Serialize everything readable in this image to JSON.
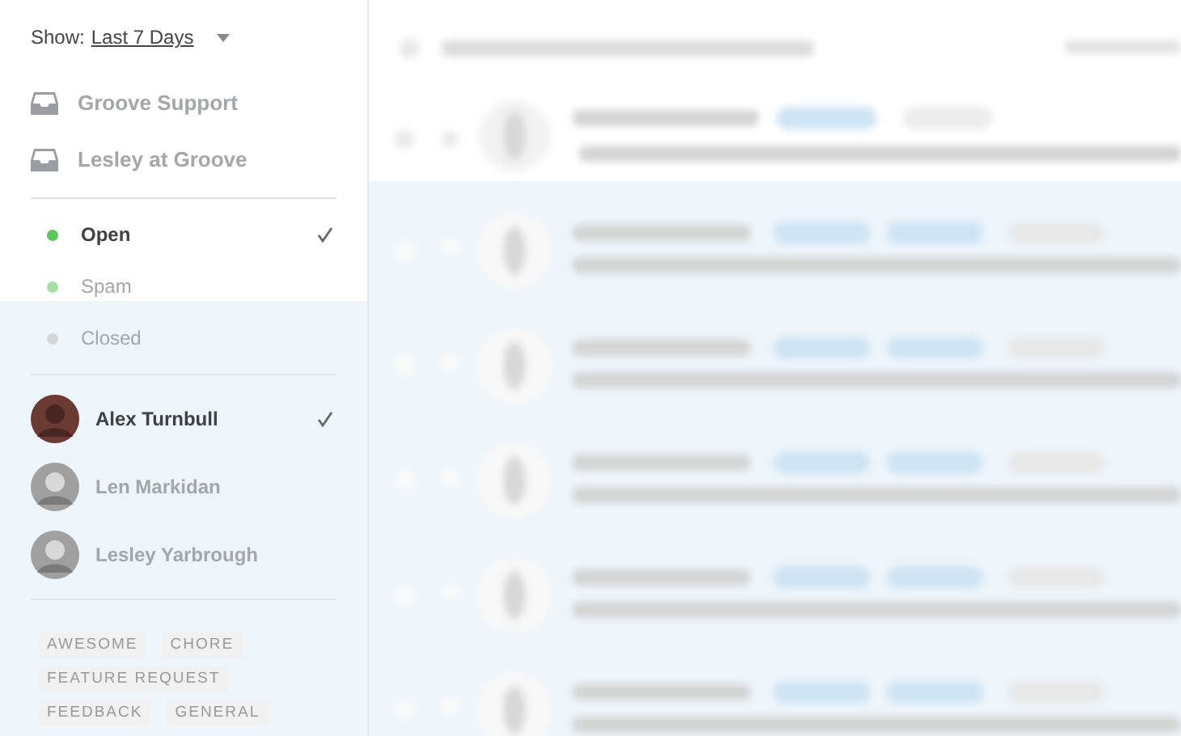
{
  "filter": {
    "label": "Show:",
    "value": "Last 7 Days"
  },
  "mailboxes": [
    {
      "name": "Groove Support"
    },
    {
      "name": "Lesley at Groove"
    }
  ],
  "statuses": [
    {
      "label": "Open",
      "color": "#5cc65c",
      "selected": true
    },
    {
      "label": "Spam",
      "color": "#a6e0a0",
      "selected": false
    },
    {
      "label": "Closed",
      "color": "#d6d6d6",
      "selected": false
    }
  ],
  "agents": [
    {
      "name": "Alex Turnbull",
      "selected": true
    },
    {
      "name": "Len Markidan",
      "selected": false
    },
    {
      "name": "Lesley Yarbrough",
      "selected": false
    }
  ],
  "tags": [
    "AWESOME",
    "CHORE",
    "FEATURE REQUEST",
    "FEEDBACK",
    "GENERAL"
  ]
}
